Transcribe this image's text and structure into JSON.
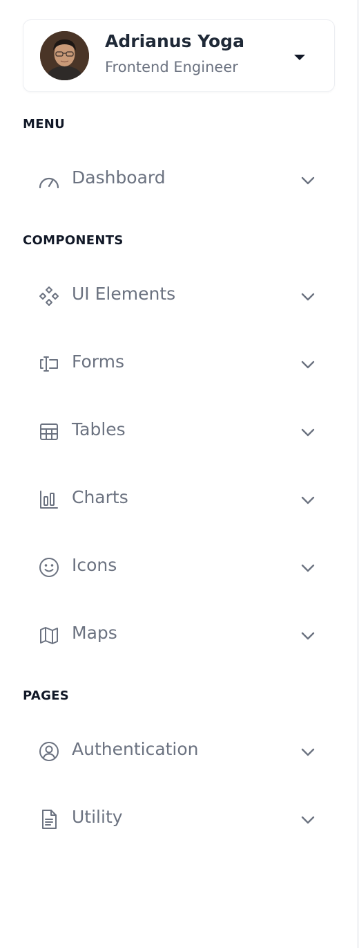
{
  "profile": {
    "name": "Adrianus Yoga",
    "role": "Frontend Engineer"
  },
  "sections": [
    {
      "title": "MENU",
      "items": [
        {
          "label": "Dashboard",
          "icon": "gauge-icon"
        }
      ]
    },
    {
      "title": "COMPONENTS",
      "items": [
        {
          "label": "UI Elements",
          "icon": "components-icon"
        },
        {
          "label": "Forms",
          "icon": "form-input-icon"
        },
        {
          "label": "Tables",
          "icon": "table-icon"
        },
        {
          "label": "Charts",
          "icon": "bar-chart-icon"
        },
        {
          "label": "Icons",
          "icon": "smiley-icon"
        },
        {
          "label": "Maps",
          "icon": "map-icon"
        }
      ]
    },
    {
      "title": "PAGES",
      "items": [
        {
          "label": "Authentication",
          "icon": "user-circle-icon"
        },
        {
          "label": "Utility",
          "icon": "document-icon"
        }
      ]
    }
  ],
  "colors": {
    "text_primary": "#1f2937",
    "text_muted": "#6b7280",
    "icon": "#6b7280",
    "border": "#eceef2"
  }
}
